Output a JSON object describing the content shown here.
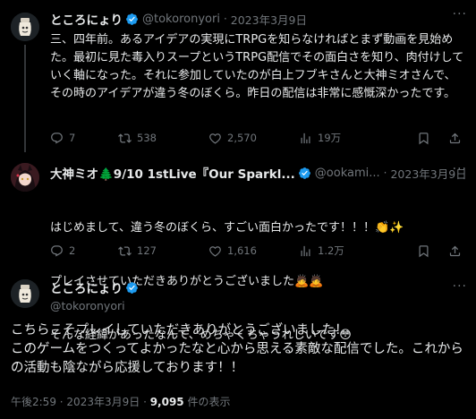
{
  "tweet1": {
    "name": "ところにょり",
    "handle": "@tokoronyori",
    "date": "2023年3月9日",
    "text": "三、四年前。あるアイデアの実現にTRPGを知らなければとまず動画を見始めた。最初に見た毒入りスープというTRPG配信でその面白さを知り、肉付けしていく軸になった。それに参加していたのが白上フブキさんと大神ミオさんで、その時のアイデアが違う冬のぼくら。昨日の配信は非常に感慨深かったです。",
    "replies": "7",
    "retweets": "538",
    "likes": "2,570",
    "views": "19万"
  },
  "tweet2": {
    "name": "大神ミオ🌲9/10 1stLive『Our Sparkl...",
    "handle": "@ookami...",
    "date": "2023年3月9日",
    "line1": "はじめまして、違う冬のぼくら、すごい面白かったです！！！👏✨",
    "line2": "プレイさせていただきありがとうございました🙇🙇",
    "line3": "そんな経緯があったなんて、めちゃくちゃうれしいです😳",
    "replies": "2",
    "retweets": "127",
    "likes": "1,616",
    "views": "1.2万"
  },
  "main": {
    "name": "ところにょり",
    "handle": "@tokoronyori",
    "text": "こちらこそプレイしていただきありがとうございました！\nこのゲームをつくってよかったなと心から思える素敵な配信でした。これからの活動も陰ながら応援しております！！",
    "time": "午後2:59",
    "date": "2023年3月9日",
    "views": "9,095",
    "views_label": "件の表示"
  },
  "colors": {
    "background": "#000000",
    "text": "#e7e9ea",
    "muted": "#71767b",
    "verified": "#1d9bf0"
  },
  "icons": [
    "reply-icon",
    "retweet-icon",
    "like-icon",
    "views-icon",
    "bookmark-icon",
    "share-icon",
    "verified-icon",
    "more-icon"
  ]
}
